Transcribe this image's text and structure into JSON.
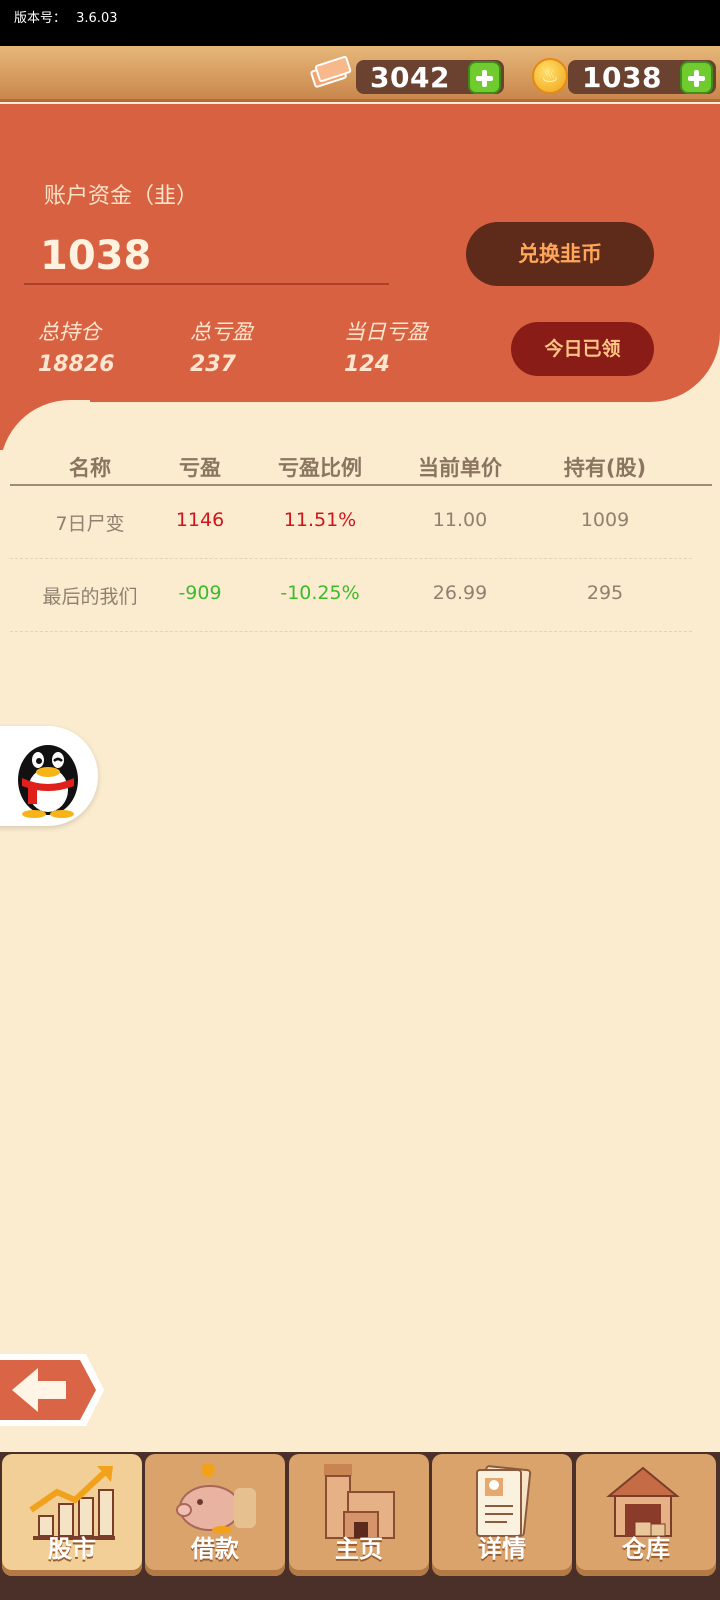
{
  "status_bar": {
    "version_label": "版本号：",
    "version": "3.6.03"
  },
  "resources": {
    "tickets": {
      "value": "3042",
      "icon": "ticket-icon"
    },
    "coins": {
      "value": "1038",
      "icon": "coin-icon"
    }
  },
  "account": {
    "label": "账户资金（韭）",
    "value": "1038",
    "exchange_button": "兑换韭币",
    "claimed_button": "今日已领",
    "stats": [
      {
        "label": "总持仓",
        "value": "18826"
      },
      {
        "label": "总亏盈",
        "value": "237"
      },
      {
        "label": "当日亏盈",
        "value": "124"
      }
    ]
  },
  "table": {
    "headers": [
      "名称",
      "亏盈",
      "亏盈比例",
      "当前单价",
      "持有(股)"
    ],
    "rows": [
      {
        "name": "7日尸变",
        "pnl": "1146",
        "pnl_pct": "11.51%",
        "price": "11.00",
        "shares": "1009",
        "trend": "up"
      },
      {
        "name": "最后的我们",
        "pnl": "-909",
        "pnl_pct": "-10.25%",
        "price": "26.99",
        "shares": "295",
        "trend": "down"
      }
    ]
  },
  "colors": {
    "accent": "#d86142",
    "up": "#d1161b",
    "down": "#3fba2b",
    "background": "#fbecd0"
  },
  "nav": [
    {
      "label": "股市",
      "icon": "stock-chart-icon",
      "active": true
    },
    {
      "label": "借款",
      "icon": "piggy-bank-icon",
      "active": false
    },
    {
      "label": "主页",
      "icon": "house-icon",
      "active": false
    },
    {
      "label": "详情",
      "icon": "document-icon",
      "active": false
    },
    {
      "label": "仓库",
      "icon": "warehouse-icon",
      "active": false
    }
  ]
}
